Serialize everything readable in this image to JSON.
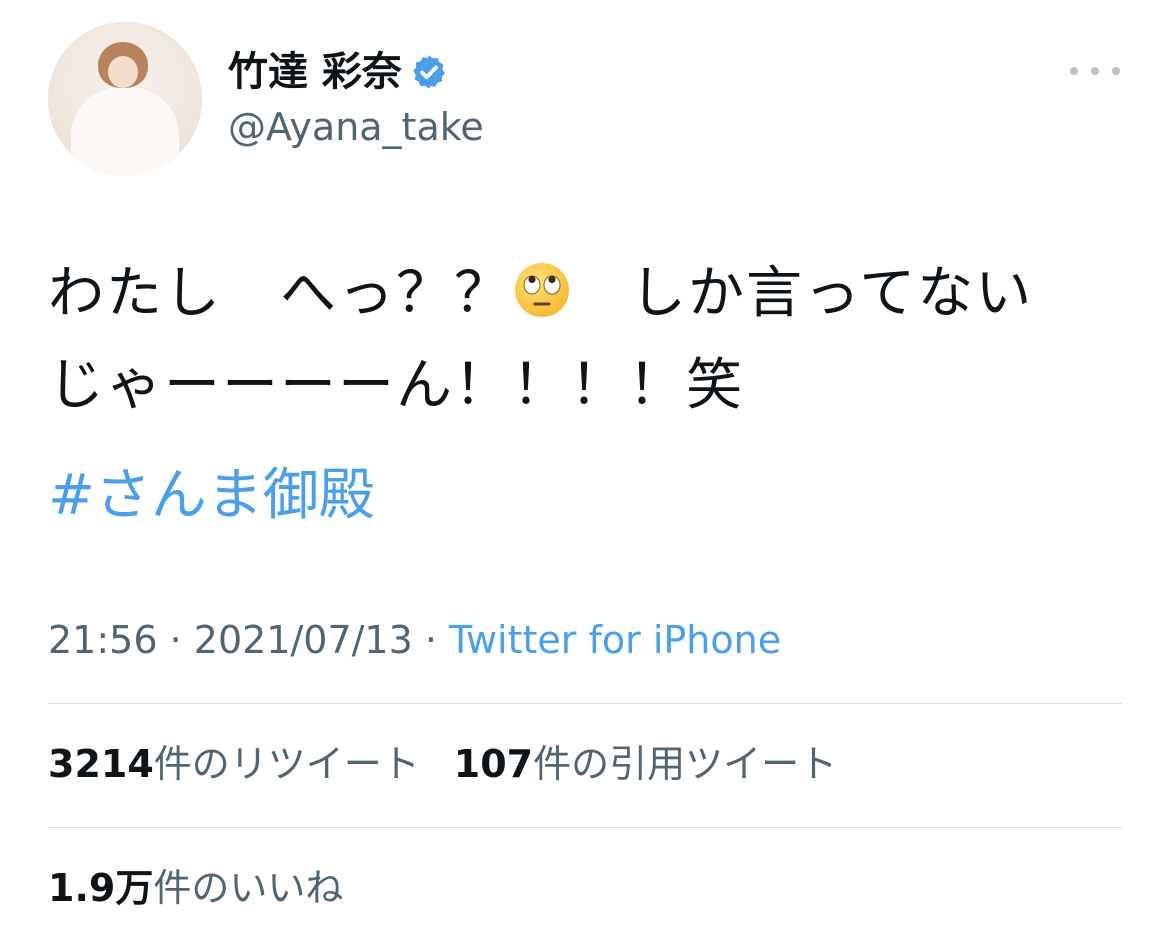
{
  "author": {
    "display_name": "竹達 彩奈",
    "handle": "@Ayana_take",
    "verified": true,
    "verified_color": "#4a9fe8"
  },
  "tweet": {
    "line1_a": "わたし　へっ？？",
    "emoji": "face-with-rolling-eyes",
    "line1_b": "　しか言ってない",
    "line2": "じゃーーーーん！！！！笑",
    "hashtag": "#さんま御殿"
  },
  "meta": {
    "time": "21:56",
    "separator1": " · ",
    "date": "2021/07/13",
    "separator2": " · ",
    "source": "Twitter for iPhone"
  },
  "stats": {
    "retweets_count": "3214",
    "retweets_label": "件のリツイート",
    "quotes_count": "107",
    "quotes_label": "件の引用ツイート",
    "likes_count": "1.9万",
    "likes_label": "件のいいね"
  },
  "colors": {
    "link": "#4a9fe8",
    "muted": "#536471",
    "text": "#0f1419"
  }
}
